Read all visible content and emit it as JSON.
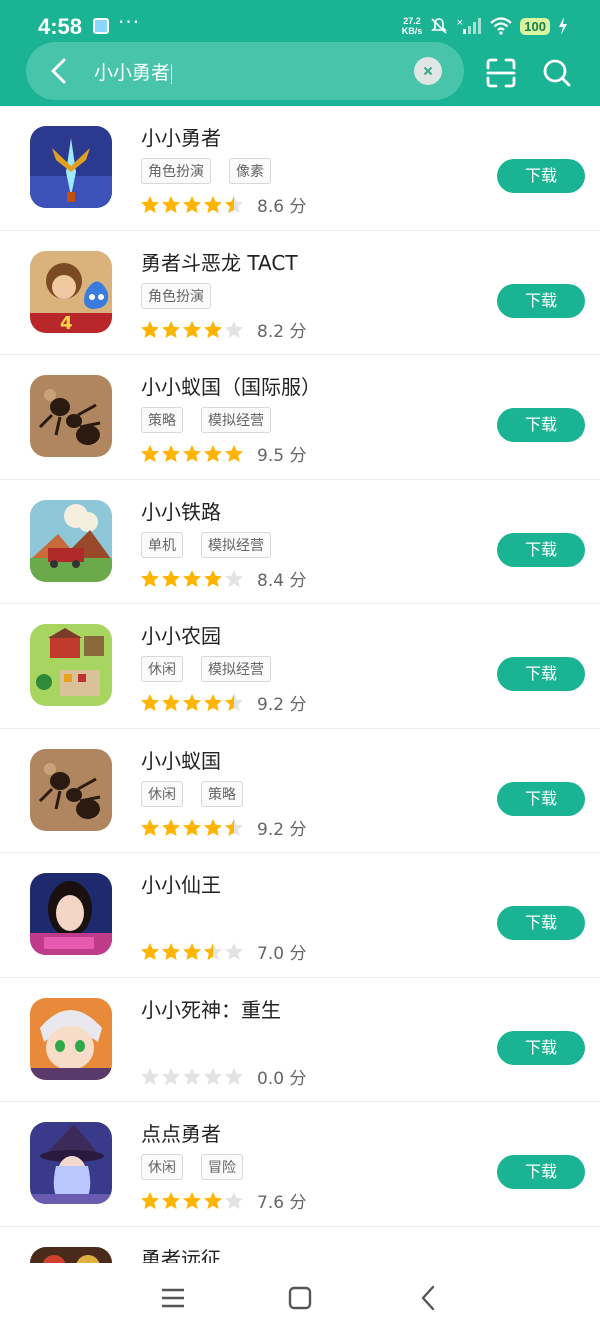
{
  "status_bar": {
    "time": "4:58",
    "dots": "···",
    "net_speed_value": "27.2",
    "net_speed_unit": "KB/s",
    "battery": "100"
  },
  "search": {
    "query": "小小勇者"
  },
  "colors": {
    "accent": "#1ab394",
    "star_filled": "#ffb400",
    "star_empty": "#e3e3e3"
  },
  "apps": [
    {
      "name": "小小勇者",
      "tags": [
        "角色扮演",
        "像素"
      ],
      "stars": 4.5,
      "score": "8.6 分",
      "button": "下载",
      "icon": "sword-game-icon"
    },
    {
      "name": "勇者斗恶龙 TACT",
      "tags": [
        "角色扮演"
      ],
      "stars": 4,
      "score": "8.2 分",
      "button": "下载",
      "icon": "dragon-quest-icon"
    },
    {
      "name": "小小蚁国（国际服）",
      "tags": [
        "策略",
        "模拟经营"
      ],
      "stars": 5,
      "score": "9.5 分",
      "button": "下载",
      "icon": "ant-icon"
    },
    {
      "name": "小小铁路",
      "tags": [
        "单机",
        "模拟经营"
      ],
      "stars": 4,
      "score": "8.4 分",
      "button": "下载",
      "icon": "train-icon"
    },
    {
      "name": "小小农园",
      "tags": [
        "休闲",
        "模拟经营"
      ],
      "stars": 4.5,
      "score": "9.2 分",
      "button": "下载",
      "icon": "farm-icon"
    },
    {
      "name": "小小蚁国",
      "tags": [
        "休闲",
        "策略"
      ],
      "stars": 4.5,
      "score": "9.2 分",
      "button": "下载",
      "icon": "ant-icon"
    },
    {
      "name": "小小仙王",
      "tags": [],
      "stars": 3.5,
      "score": "7.0 分",
      "button": "下载",
      "icon": "fairy-king-icon"
    },
    {
      "name": "小小死神：重生",
      "tags": [],
      "stars": 0,
      "score": "0.0 分",
      "button": "下载",
      "icon": "reaper-icon"
    },
    {
      "name": "点点勇者",
      "tags": [
        "休闲",
        "冒险"
      ],
      "stars": 4,
      "score": "7.6 分",
      "button": "下载",
      "icon": "witch-icon"
    },
    {
      "name": "勇者远征",
      "tags": [],
      "stars": 0,
      "score": "",
      "button": "",
      "icon": "expedition-icon"
    }
  ]
}
